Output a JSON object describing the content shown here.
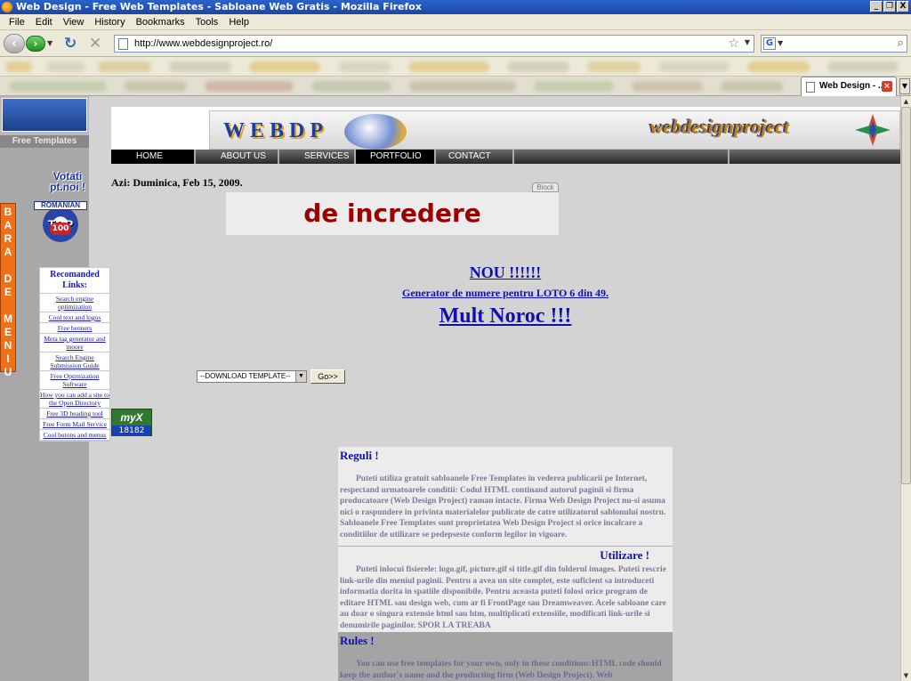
{
  "window": {
    "title": "Web Design - Free Web Templates - Sabloane Web Gratis - Mozilla Firefox",
    "controls": [
      "_",
      "❐",
      "X"
    ]
  },
  "menu": {
    "file": "File",
    "edit": "Edit",
    "view": "View",
    "history": "History",
    "bookmarks": "Bookmarks",
    "tools": "Tools",
    "help": "Help"
  },
  "nav": {
    "url": "http://www.webdesignproject.ro/",
    "search_placeholder": ""
  },
  "tab": {
    "label": "Web Design - ..."
  },
  "site": {
    "thumb_label": "Free Templates",
    "votati": [
      "Votati",
      "pt.noi !"
    ],
    "top_badge": {
      "banner": "ROMANIAN",
      "word": "TOP",
      "number": "100"
    },
    "bara_menu": [
      "B",
      "A",
      "R",
      "A",
      " ",
      "D",
      "E",
      " ",
      "M",
      "E",
      "N",
      "I",
      "U"
    ],
    "header": {
      "left_word": "WEBDP",
      "right_word": "webdesignproject"
    },
    "topnav": [
      {
        "label": "HOME",
        "active": true
      },
      {
        "label": "ABOUT US",
        "active": false
      },
      {
        "label": "SERVICES",
        "active": false
      },
      {
        "label": "PORTFOLIO",
        "active": true
      },
      {
        "label": "CONTACT",
        "active": false
      }
    ],
    "date": "Azi: Duminica, Feb 15, 2009.",
    "block_tag": "Block",
    "ad_text": "de incredere",
    "rec_links": {
      "title": "Recomanded Links:",
      "items": [
        "Search engine optimization",
        "Cool text and logos",
        "Free benners",
        "Meta tag generator and moore",
        "Search Engine Submission Guide",
        "Free Optimization Software",
        "How you can add a site to the Open Directory",
        "Free 3D heading tool",
        "Free Form Mail Service",
        "Cool butons and menus"
      ]
    },
    "myx": {
      "logo": "myX",
      "count": "18182"
    },
    "nou": "NOU !!!!!!",
    "generator": "Generator de numere pentru LOTO 6 din 49.",
    "noroc": "Mult Noroc !!!",
    "download_select": "--DOWNLOAD TEMPLATE--",
    "go_label": "Go>>",
    "rules": {
      "h1": "Reguli !",
      "p1": "Puteti utiliza gratuit sabloanele Free Templates in vederea publicarii pe Internet, respectand urmatoarele conditii: Codul HTML continand autorul paginii si firma producatoare (Web Design Project) raman intacte. Firma Web Design Project nu-si asuma nici o raspundere in privinta materialelor publicate de catre utilizatorul sablonului nostru. Sabloanele Free Templates sunt proprietatea Web Design Project si orice incalcare a conditiilor de utilizare se pedepseste conform legilor in vigoare.",
      "h2": "Utilizare !",
      "p2": "Puteti inlocui fisierele: logo.gif, picture.gif si title.gif din folderul images. Puteti rescrie link-urile din meniul paginii. Pentru a avea un site complet, este suficient sa introduceti informatia dorita in spatiile disponibile. Pentru aceasta puteti folosi orice program de editare HTML sau design web, cum ar fi FrontPage sau Dreamweaver. Acele sabloane care au doar o singura extensie html sau htm, multiplicati extensiile, modificati link-urile si denumirile paginilor. SPOR LA TREABA",
      "h3": "Rules !",
      "p3": "You can use free templates for your own, only in these conditions:HTML code should keep the author's name and the producting firm (Web Design Project). Web"
    }
  }
}
